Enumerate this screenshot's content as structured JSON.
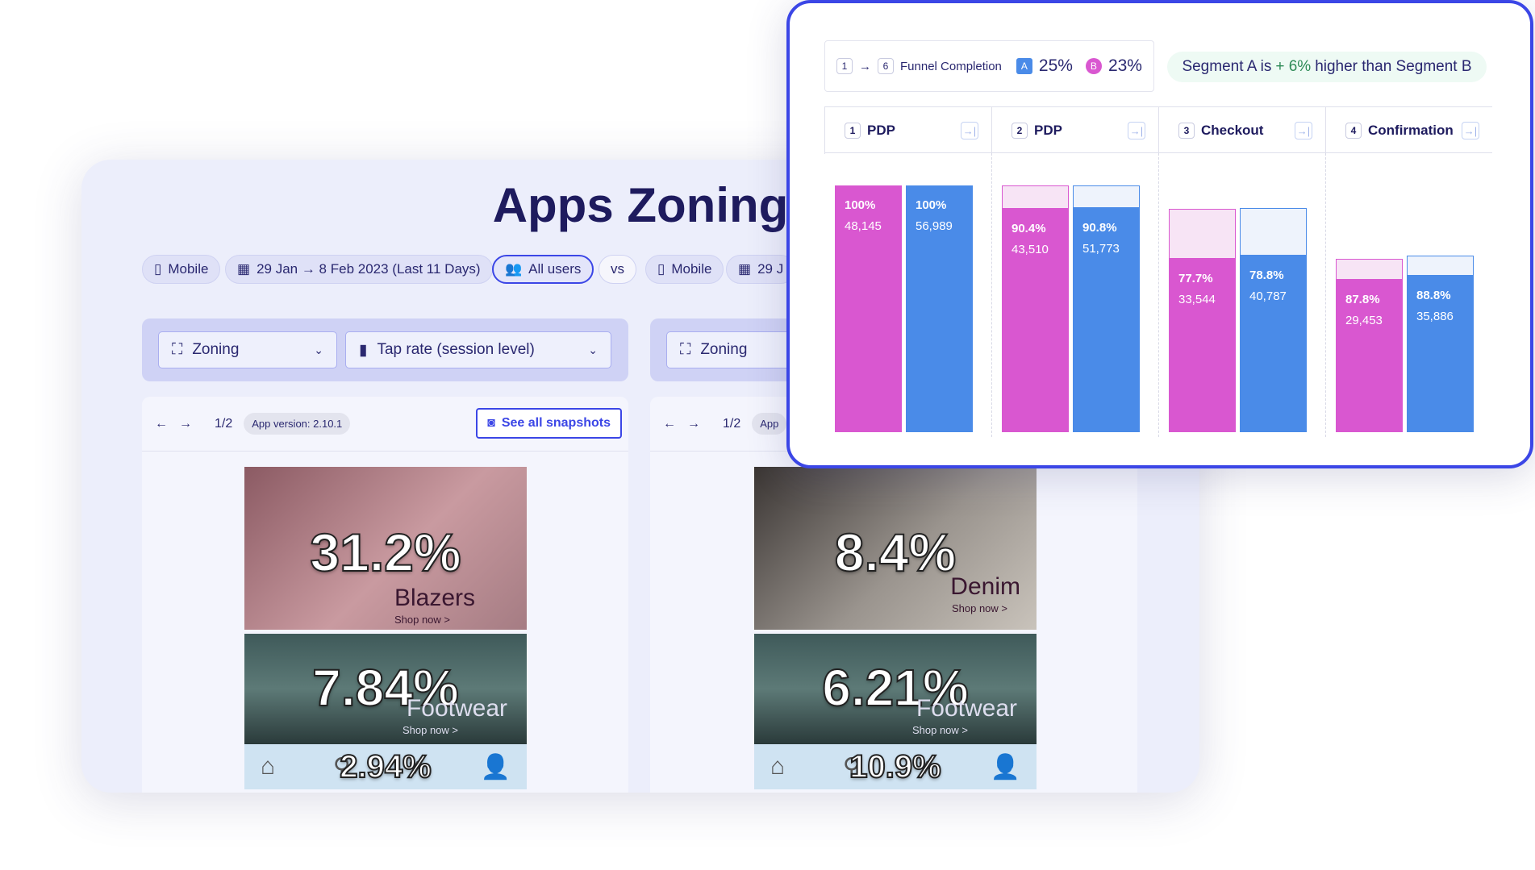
{
  "main": {
    "title": "Apps Zoning",
    "chips": [
      {
        "icon": "phone-icon",
        "label": "Mobile"
      },
      {
        "icon": "calendar-icon",
        "label": "29 Jan → 8 Feb 2023 (Last 11 Days)"
      },
      {
        "icon": "users-icon",
        "label": "All users",
        "selected": true
      },
      {
        "label": "vs"
      },
      {
        "icon": "phone-icon",
        "label": "Mobile"
      },
      {
        "icon": "calendar-icon",
        "label": "29 J"
      }
    ],
    "left": {
      "mode_dropdown": "Zoning",
      "metric_dropdown": "Tap rate (session level)",
      "page": "1/2",
      "app_version": "App version: 2.10.1",
      "see_all": "See all snapshots",
      "tiles": [
        {
          "value": "31.2%",
          "label": "Blazers",
          "cta": "Shop now >"
        },
        {
          "value": "7.84%",
          "label": "Footwear",
          "cta": "Shop now >"
        }
      ],
      "nav_value": "2.94%"
    },
    "right": {
      "mode_dropdown": "Zoning",
      "page": "1/2",
      "app_version": "App",
      "tiles": [
        {
          "value": "8.4%",
          "label": "Denim",
          "cta": "Shop now >"
        },
        {
          "value": "6.21%",
          "label": "Footwear",
          "cta": "Shop now >"
        }
      ],
      "nav_value": "10.9%"
    }
  },
  "funnel": {
    "from_step": "1",
    "to_step": "6",
    "completion_label": "Funnel Completion",
    "seg_a": {
      "label": "A",
      "value": "25%",
      "color": "#4a8be8"
    },
    "seg_b": {
      "label": "B",
      "value": "23%",
      "color": "#d957d0"
    },
    "compare": {
      "prefix": "Segment A is",
      "delta": "+ 6%",
      "suffix": "higher than Segment B"
    }
  },
  "chart_data": {
    "type": "bar",
    "categories": [
      {
        "num": "1",
        "name": "PDP"
      },
      {
        "num": "2",
        "name": "PDP"
      },
      {
        "num": "3",
        "name": "Checkout"
      },
      {
        "num": "4",
        "name": "Confirmation"
      }
    ],
    "series": [
      {
        "segment": "B",
        "color": "#d957d0",
        "ghost": "#f7e4f5",
        "step_rates": [
          "100%",
          "90.4%",
          "77.7%",
          "87.8%"
        ],
        "counts": [
          "48,145",
          "43,510",
          "33,544",
          "29,453"
        ],
        "rates": [
          1,
          0.904,
          0.777,
          0.878
        ]
      },
      {
        "segment": "A",
        "color": "#4a8be8",
        "ghost": "#eef3fc",
        "step_rates": [
          "100%",
          "90.8%",
          "78.8%",
          "88.8%"
        ],
        "counts": [
          "56,989",
          "51,773",
          "40,787",
          "35,886"
        ],
        "rates": [
          1,
          0.908,
          0.788,
          0.888
        ]
      }
    ]
  }
}
